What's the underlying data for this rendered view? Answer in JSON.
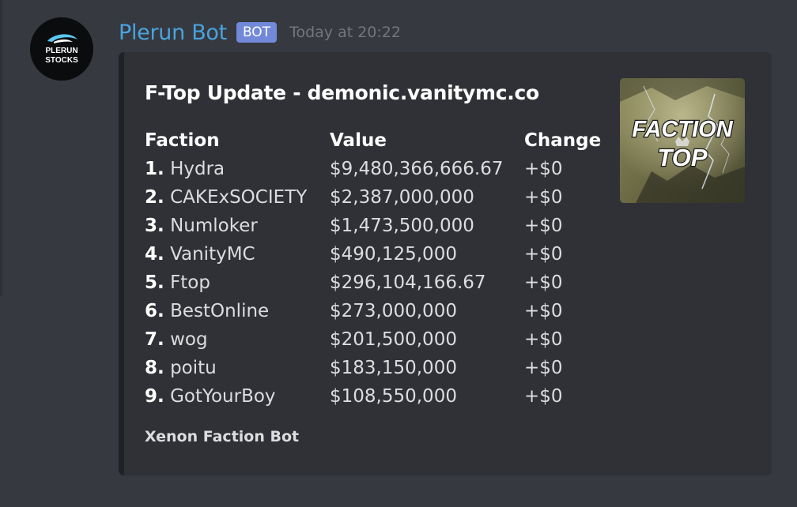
{
  "message": {
    "username": "Plerun Bot",
    "badge": "BOT",
    "timestamp": "Today at 20:22",
    "avatar_text": [
      "PLERUN",
      "STOCKS"
    ],
    "avatar_icon": "plerun-stocks-logo"
  },
  "embed": {
    "title": "F-Top Update - demonic.vanitymc.co",
    "thumbnail_text": [
      "FACTION",
      "TOP"
    ],
    "thumbnail_icon": "faction-top-thumbnail",
    "columns": {
      "faction": "Faction",
      "value": "Value",
      "change": "Change"
    },
    "rows": [
      {
        "rank": "1.",
        "name": "Hydra",
        "value": "$9,480,366,666.67",
        "change": "+$0"
      },
      {
        "rank": "2.",
        "name": "CAKExSOCIETY",
        "value": "$2,387,000,000",
        "change": "+$0"
      },
      {
        "rank": "3.",
        "name": "Numloker",
        "value": "$1,473,500,000",
        "change": "+$0"
      },
      {
        "rank": "4.",
        "name": "VanityMC",
        "value": "$490,125,000",
        "change": "+$0"
      },
      {
        "rank": "5.",
        "name": "Ftop",
        "value": "$296,104,166.67",
        "change": "+$0"
      },
      {
        "rank": "6.",
        "name": "BestOnline",
        "value": "$273,000,000",
        "change": "+$0"
      },
      {
        "rank": "7.",
        "name": "wog",
        "value": "$201,500,000",
        "change": "+$0"
      },
      {
        "rank": "8.",
        "name": "poitu",
        "value": "$183,150,000",
        "change": "+$0"
      },
      {
        "rank": "9.",
        "name": "GotYourBoy",
        "value": "$108,550,000",
        "change": "+$0"
      }
    ],
    "footer": "Xenon Faction Bot"
  },
  "colors": {
    "background": "#36393f",
    "embed_background": "#2f3136",
    "username": "#4aa3df",
    "badge": "#7289da",
    "timestamp": "#72767d",
    "text": "#dcddde"
  }
}
